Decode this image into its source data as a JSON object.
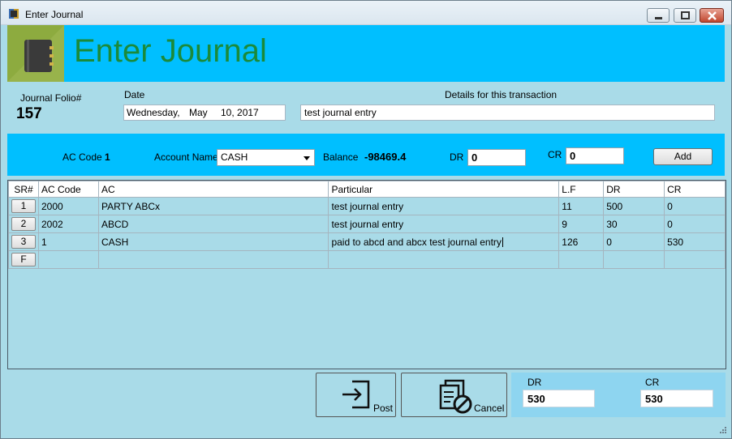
{
  "window": {
    "title": "Enter Journal"
  },
  "banner": {
    "title": "Enter Journal",
    "logo": "notebook-icon"
  },
  "form": {
    "folio_label": "Journal Folio#",
    "folio_value": "157",
    "date_label": "Date",
    "date_day": "Wednesday,",
    "date_month": "May",
    "date_rest": "10, 2017",
    "details_label": "Details for this transaction",
    "details_value": "test journal entry"
  },
  "entry": {
    "ac_code_label": "AC Code",
    "ac_code_value": "1",
    "account_name_label": "Account Name",
    "account_name_value": "CASH",
    "balance_label": "Balance",
    "balance_value": "-98469.4",
    "dr_label": "DR",
    "dr_value": "0",
    "cr_label": "CR",
    "cr_value": "0",
    "add_label": "Add"
  },
  "grid": {
    "headers": [
      "SR#",
      "AC Code",
      "AC",
      "Particular",
      "L.F",
      "DR",
      "CR"
    ],
    "rows": [
      {
        "sr": "1",
        "ac_code": "2000",
        "ac": "PARTY ABCx",
        "particular": "test journal entry",
        "lf": "11",
        "dr": "500",
        "cr": "0"
      },
      {
        "sr": "2",
        "ac_code": "2002",
        "ac": "ABCD",
        "particular": "test journal entry",
        "lf": "9",
        "dr": "30",
        "cr": "0"
      },
      {
        "sr": "3",
        "ac_code": "1",
        "ac": "CASH",
        "particular": "paid to abcd and abcx test journal entry",
        "lf": "126",
        "dr": "0",
        "cr": "530"
      },
      {
        "sr": "F",
        "ac_code": "",
        "ac": "",
        "particular": "",
        "lf": "",
        "dr": "",
        "cr": ""
      }
    ]
  },
  "actions": {
    "post_label": "Post",
    "cancel_label": "Cancel"
  },
  "totals": {
    "dr_label": "DR",
    "dr_value": "530",
    "cr_label": "CR",
    "cr_value": "530"
  },
  "colors": {
    "banner": "#00bfff",
    "title_green": "#1b8a3a",
    "panel": "#a9dbe8",
    "logo_bg": "#8dab3f"
  }
}
